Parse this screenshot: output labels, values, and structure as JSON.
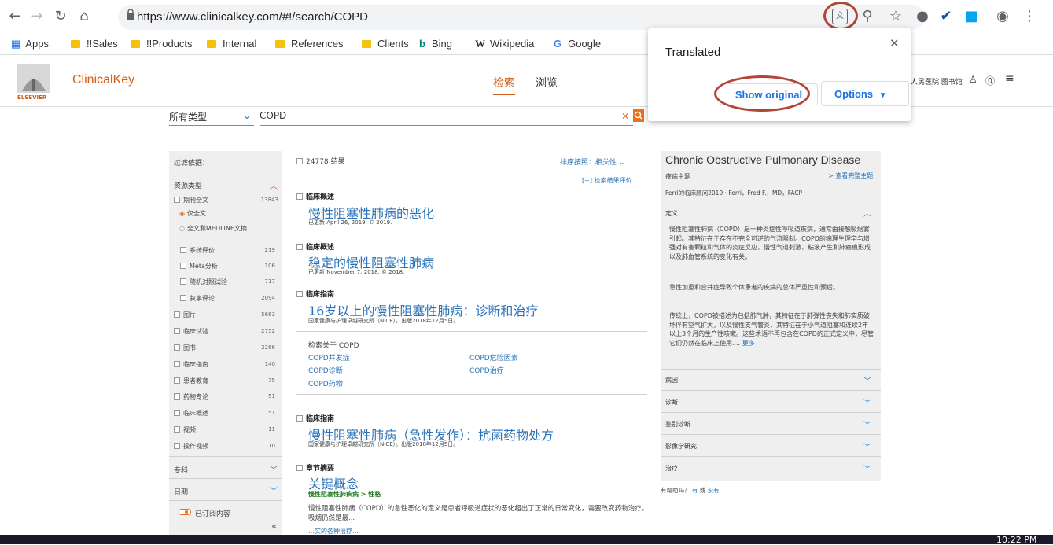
{
  "browser": {
    "url": "https://www.clinicalkey.com/#!/search/COPD",
    "bookmarks": [
      "Apps",
      "!!Sales",
      "!!Products",
      "Internal",
      "References",
      "Clients",
      "Bing",
      "Wikipedia",
      "Google"
    ]
  },
  "translate_popup": {
    "title": "Translated",
    "show_original": "Show original",
    "options": "Options"
  },
  "site": {
    "logo": "ClinicalKey",
    "logo_sub": "ELSEVIER",
    "nav": [
      "检索",
      "浏览"
    ],
    "user_info": "人民医院 图书馆"
  },
  "search": {
    "type": "所有类型",
    "query": "COPD"
  },
  "filters": {
    "title": "过滤依据：",
    "resource_header": "资源类型",
    "items": [
      {
        "label": "期刊全文",
        "count": "13843"
      },
      {
        "label": "仅全文",
        "count": ""
      },
      {
        "label": "全文和MEDLINE文摘",
        "count": ""
      },
      {
        "label": "系统评价",
        "count": "219"
      },
      {
        "label": "Meta分析",
        "count": "106"
      },
      {
        "label": "随机对照试验",
        "count": "717"
      },
      {
        "label": "叙事评论",
        "count": "2094"
      },
      {
        "label": "图片",
        "count": "5663"
      },
      {
        "label": "临床试验",
        "count": "2752"
      },
      {
        "label": "图书",
        "count": "2266"
      },
      {
        "label": "临床指南",
        "count": "140"
      },
      {
        "label": "患者教育",
        "count": "75"
      },
      {
        "label": "药物专论",
        "count": "51"
      },
      {
        "label": "临床概述",
        "count": "51"
      },
      {
        "label": "视频",
        "count": "11"
      },
      {
        "label": "操作视频",
        "count": "10"
      }
    ],
    "specialty": "专科",
    "date": "日期",
    "subscribed": "已订阅内容"
  },
  "results": {
    "count": "24778 结果",
    "sort": "排序按照：相关性",
    "feedback": "[+] 检索结果评价",
    "items": [
      {
        "type": "临床概述",
        "title": "慢性阻塞性肺病的恶化",
        "meta": "已更新 April 26, 2019. © 2019."
      },
      {
        "type": "临床概述",
        "title": "稳定的慢性阻塞性肺病",
        "meta": "已更新 November 7, 2018. © 2018."
      },
      {
        "type": "临床指南",
        "title": "16岁以上的慢性阻塞性肺病：诊断和治疗",
        "meta": "国家健康与护理卓越研究所（NICE）。出版2018年12月5日。"
      },
      {
        "type": "临床指南",
        "title": "慢性阻塞性肺病（急性发作）：抗菌药物处方",
        "meta": "国家健康与护理卓越研究所（NICE）。出版2018年12月5日。"
      },
      {
        "type": "章节摘要",
        "title": "关键概念",
        "meta": "慢性阻塞性肺疾病 > 性格"
      }
    ],
    "related_title": "检索关于 COPD",
    "related": [
      "COPD并发症",
      "COPD危险因素",
      "COPD诊断",
      "COPD治疗",
      "COPD药物"
    ],
    "last_snippet": "慢性阻塞性肺病（COPD）的急性恶化的定义是患者呼吸道症状的恶化超出了正常的日常变化，需要改变药物治疗。吸烟仍然是最...",
    "last_snippet2": "…实的各种治疗…"
  },
  "topic": {
    "title": "Chronic Obstructive Pulmonary Disease",
    "section": "疾病主题",
    "view_all": "> 查看完整主题",
    "source": "Ferri的临床顾问2019 · Ferri，Fred F.，MD，FACP",
    "def_header": "定义",
    "p1": "慢性阻塞性肺病（COPD）是一种炎症性呼吸道疾病，通常由接触吸烟雾引起。其特征在于存在不完全可逆的气流限制。COPD的病理生理学与增强对有害颗粒和气体的炎症反应，慢性气道刺激，粘液产生和肺瘢痕形成以及肺血管系统的变化有关。",
    "p2": "急性加重和合并症导致个体患者的疾病的总体严重性和预后。",
    "p3": "传统上，COPD被描述为包括肺气肿，其特征在于肺弹性丧失和肺实质破坏伴有空气扩大，以及慢性支气管炎，其特征在于小气道阻塞和连续2年以上3个月的生产性咳嗽。这些术语不再包含在COPD的正式定义中，尽管它们仍然在临床上使用....",
    "more": "更多",
    "accordions": [
      "病因",
      "诊断",
      "鉴别诊断",
      "影像学研究",
      "治疗"
    ],
    "helpful": "有帮助吗？",
    "yes": "有",
    "or": "或",
    "no": "没有"
  },
  "taskbar": {
    "time": "10:22 PM"
  }
}
